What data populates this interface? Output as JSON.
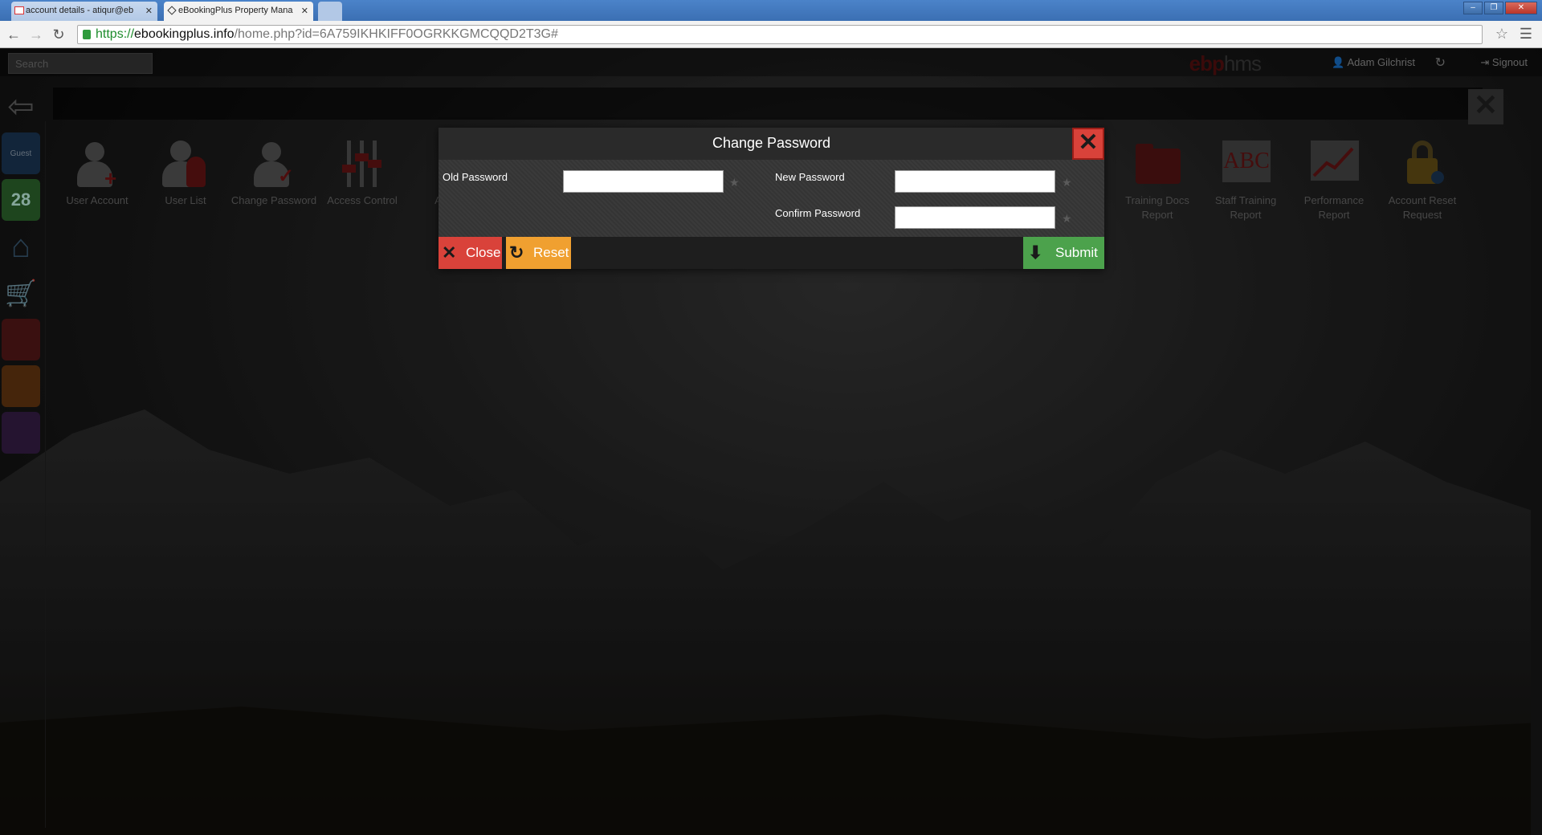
{
  "browser": {
    "tabs": [
      {
        "label": "account details - atiqur@eb",
        "active": false
      },
      {
        "label": "eBookingPlus Property Mana",
        "active": true
      }
    ],
    "url": {
      "scheme": "https://",
      "host": "ebookingplus.info",
      "path": "/home.php?id=6A759IKHKIFF0OGRKKGMCQQD2T3G#"
    }
  },
  "topbar": {
    "search_placeholder": "Search",
    "brand_part1": "ebp",
    "brand_part2": "hms",
    "user_name": "Adam Gilchrist",
    "signout_label": "Signout"
  },
  "rail": {
    "guest_label": "Guest",
    "calendar_day": "28"
  },
  "tiles": [
    {
      "label": "User Account",
      "icon": "user-add-icon"
    },
    {
      "label": "User List",
      "icon": "user-list-icon"
    },
    {
      "label": "Change Password",
      "icon": "user-check-icon"
    },
    {
      "label": "Access Control",
      "icon": "sliders-icon"
    },
    {
      "label": "Acce...",
      "icon": "access-icon"
    },
    {
      "label": "Training Docs Report",
      "icon": "folder-icon"
    },
    {
      "label": "Staff Training Report",
      "icon": "abc-icon"
    },
    {
      "label": "Performance Report",
      "icon": "chart-icon"
    },
    {
      "label": "Account Reset Request",
      "icon": "lock-icon"
    }
  ],
  "modal": {
    "title": "Change Password",
    "old_password_label": "Old Password",
    "new_password_label": "New Password",
    "confirm_password_label": "Confirm Password",
    "close_label": "Close",
    "reset_label": "Reset",
    "submit_label": "Submit"
  },
  "colors": {
    "close_red": "#d9423a",
    "reset_orange": "#f0a030",
    "submit_green": "#4ca24c"
  }
}
